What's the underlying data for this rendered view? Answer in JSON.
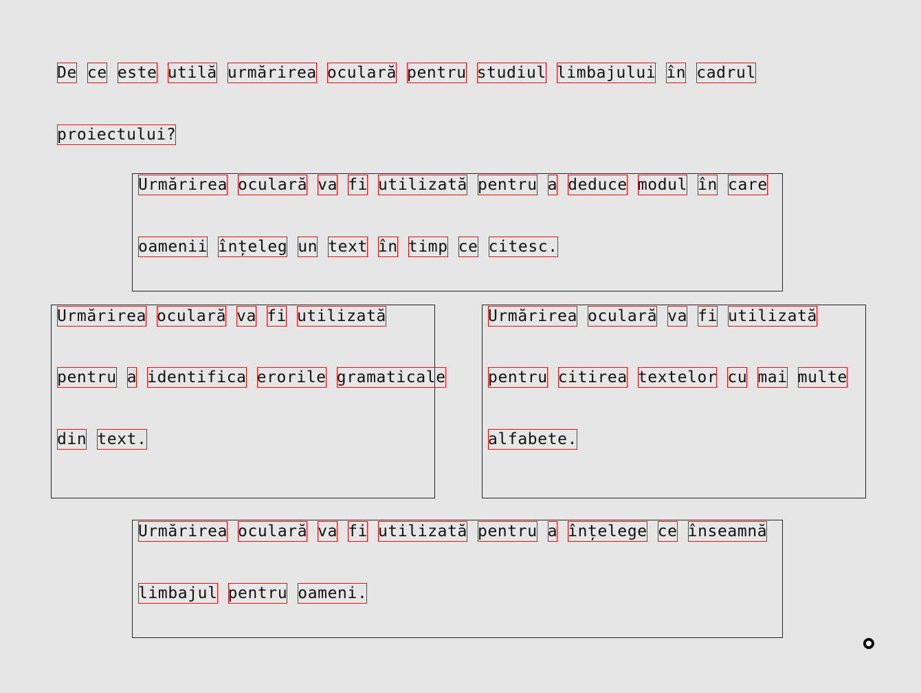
{
  "question": {
    "lines": [
      "De ce este utilă urmărirea oculară pentru studiul limbajului în cadrul",
      "proiectului?"
    ]
  },
  "options": [
    {
      "lines": [
        "Urmărirea oculară va fi utilizată pentru a deduce modul în care",
        "oamenii înțeleg un text în timp ce citesc."
      ]
    },
    {
      "lines": [
        "Urmărirea oculară va fi utilizată",
        "pentru a identifica erorile gramaticale",
        "din text."
      ]
    },
    {
      "lines": [
        "Urmărirea oculară va fi utilizată",
        "pentru citirea textelor cu mai multe",
        "alfabete."
      ]
    },
    {
      "lines": [
        "Urmărirea oculară va fi utilizată pentru a înțelege ce înseamnă",
        "limbajul pentru oameni."
      ]
    }
  ]
}
